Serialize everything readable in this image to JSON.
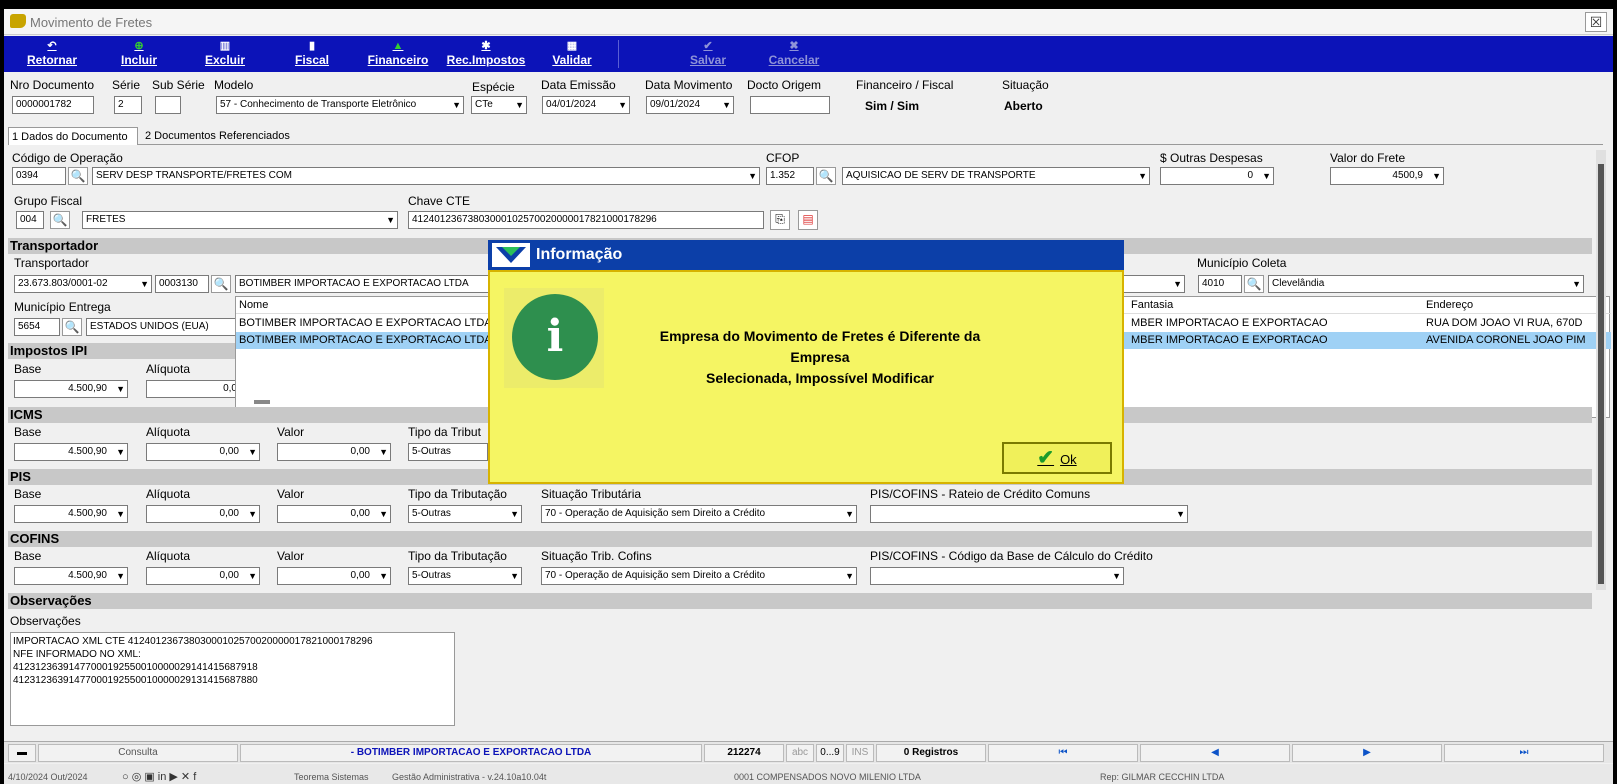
{
  "window": {
    "title": "Movimento de Fretes",
    "close": "☒"
  },
  "toolbar": {
    "retornar": "Retornar",
    "incluir": "Incluir",
    "excluir": "Excluir",
    "fiscal": "Fiscal",
    "financeiro": "Financeiro",
    "rec_impostos": "Rec.Impostos",
    "validar": "Validar",
    "salvar": "Salvar",
    "cancelar": "Cancelar"
  },
  "header": {
    "nro_documento_label": "Nro Documento",
    "nro_documento": "0000001782",
    "serie_label": "Série",
    "serie": "2",
    "sub_serie_label": "Sub Série",
    "sub_serie": "",
    "modelo_label": "Modelo",
    "modelo": "57 - Conhecimento de Transporte Eletrônico",
    "especie_label": "Espécie",
    "especie": "CTe",
    "data_emissao_label": "Data Emissão",
    "data_emissao": "04/01/2024",
    "data_movimento_label": "Data Movimento",
    "data_movimento": "09/01/2024",
    "docto_origem_label": "Docto Origem",
    "docto_origem": "",
    "fin_fiscal_label": "Financeiro / Fiscal",
    "fin_fiscal": "Sim / Sim",
    "situacao_label": "Situação",
    "situacao": "Aberto"
  },
  "tabs": {
    "tab1": "1 Dados do Documento",
    "tab2": "2 Documentos Referenciados"
  },
  "operacao": {
    "codigo_label": "Código de Operação",
    "codigo": "0394",
    "descricao": "SERV DESP TRANSPORTE/FRETES COM",
    "cfop_label": "CFOP",
    "cfop": "1.352",
    "cfop_desc": "AQUISICAO DE SERV DE TRANSPORTE",
    "outras_label": "$ Outras Despesas",
    "outras": "0",
    "frete_label": "Valor do Frete",
    "frete": "4500,9",
    "grupo_label": "Grupo Fiscal",
    "grupo": "004",
    "grupo_desc": "FRETES",
    "chave_label": "Chave CTE",
    "chave": "41240123673803000102570020000017821000178296"
  },
  "transportador": {
    "section": "Transportador",
    "label": "Transportador",
    "cnpj": "23.673.803/0001-02",
    "codigo": "0003130",
    "nome": "BOTIMBER IMPORTACAO E EXPORTACAO LTDA",
    "mun_coleta_label": "Município Coleta",
    "mun_coleta_cod": "4010",
    "mun_coleta": "Clevelândia",
    "mun_entrega_label": "Município Entrega",
    "mun_entrega_cod": "5654",
    "mun_entrega": "ESTADOS UNIDOS (EUA)"
  },
  "lookup": {
    "col_nome": "Nome",
    "col_fantasia": "Fantasia",
    "col_endereco": "Endereço",
    "rows": [
      {
        "nome": "BOTIMBER IMPORTACAO E EXPORTACAO LTDA",
        "fantasia": "MBER IMPORTACAO E EXPORTACAO",
        "endereco": "RUA DOM JOAO VI RUA, 670D"
      },
      {
        "nome": "BOTIMBER IMPORTACAO E EXPORTACAO LTDA",
        "fantasia": "MBER IMPORTACAO E EXPORTACAO",
        "endereco": "AVENIDA CORONEL JOAO PIM"
      }
    ]
  },
  "ipi": {
    "section": "Impostos IPI",
    "base_label": "Base",
    "base": "4.500,90",
    "aliquota_label": "Alíquota",
    "aliquota": "0,0"
  },
  "icms": {
    "section": "ICMS",
    "base_label": "Base",
    "base": "4.500,90",
    "aliquota_label": "Alíquota",
    "aliquota": "0,00",
    "valor_label": "Valor",
    "valor": "0,00",
    "tipo_label": "Tipo da Tribut",
    "tipo": "5-Outras"
  },
  "pis": {
    "section": "PIS",
    "base_label": "Base",
    "base": "4.500,90",
    "aliquota_label": "Alíquota",
    "aliquota": "0,00",
    "valor_label": "Valor",
    "valor": "0,00",
    "tipo_label": "Tipo da Tributação",
    "tipo": "5-Outras",
    "sit_label": "Situação Tributária",
    "sit": "70 - Operação de Aquisição sem Direito a Crédito",
    "rateio_label": "PIS/COFINS - Rateio de Crédito Comuns",
    "rateio": ""
  },
  "cofins": {
    "section": "COFINS",
    "base_label": "Base",
    "base": "4.500,90",
    "aliquota_label": "Alíquota",
    "aliquota": "0,00",
    "valor_label": "Valor",
    "valor": "0,00",
    "tipo_label": "Tipo da Tributação",
    "tipo": "5-Outras",
    "sit_label": "Situação Trib. Cofins",
    "sit": "70 - Operação de Aquisição sem Direito a Crédito",
    "cod_base_label": "PIS/COFINS - Código da Base de Cálculo do Crédito",
    "cod_base": ""
  },
  "observacoes": {
    "section": "Observações",
    "label": "Observações",
    "lines": [
      "IMPORTACAO XML CTE 41240123673803000102570020000017821000178296",
      "NFE INFORMADO NO XML:",
      "41231236391477000192550010000029141415687918",
      "41231236391477000192550010000029131415687880"
    ]
  },
  "status": {
    "modo": "Consulta",
    "empresa": "- BOTIMBER IMPORTACAO E EXPORTACAO LTDA",
    "codigo": "212274",
    "abc": "abc",
    "num": "0...9",
    "ins": "INS",
    "registros": "0 Registros"
  },
  "bottom": {
    "date": "4/10/2024 Out/2024",
    "teorema": "Teorema Sistemas",
    "gestao": "Gestão Administrativa - v.24.10a10.04t",
    "empresa": "0001 COMPENSADOS NOVO MILENIO LTDA",
    "rep": "Rep: GILMAR CECCHIN LTDA"
  },
  "dialog": {
    "title": "Informação",
    "message_line1": "Empresa do Movimento de Fretes é Diferente da Empresa",
    "message_line2": "Selecionada, Impossível Modificar",
    "ok": "Ok"
  }
}
